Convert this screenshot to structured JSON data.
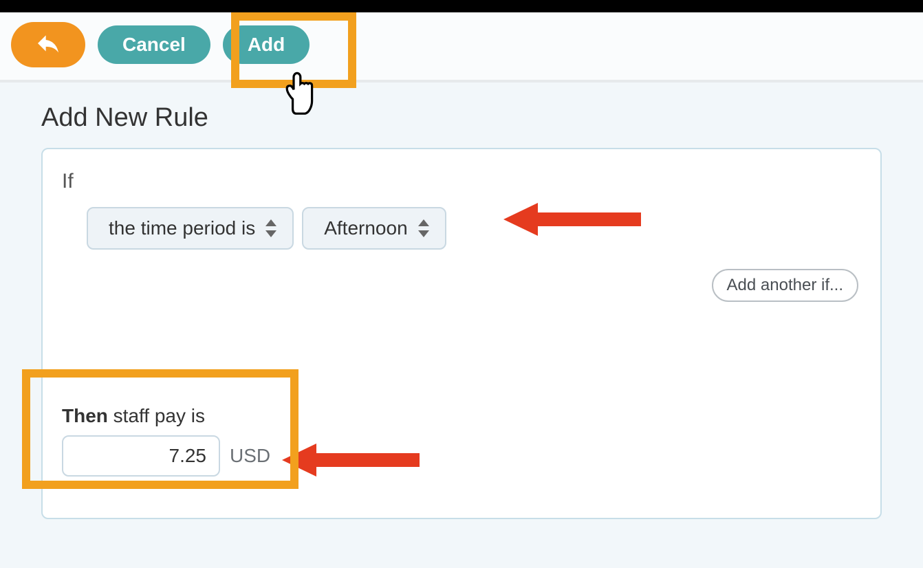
{
  "toolbar": {
    "cancel_label": "Cancel",
    "add_label": "Add"
  },
  "page": {
    "title": "Add New Rule"
  },
  "rule": {
    "if_label": "If",
    "condition_type": "the time period is",
    "condition_value": "Afternoon",
    "add_another_label": "Add another if...",
    "then_prefix": "Then",
    "then_suffix": " staff pay is",
    "pay_value": "7.25",
    "currency_label": "USD"
  }
}
